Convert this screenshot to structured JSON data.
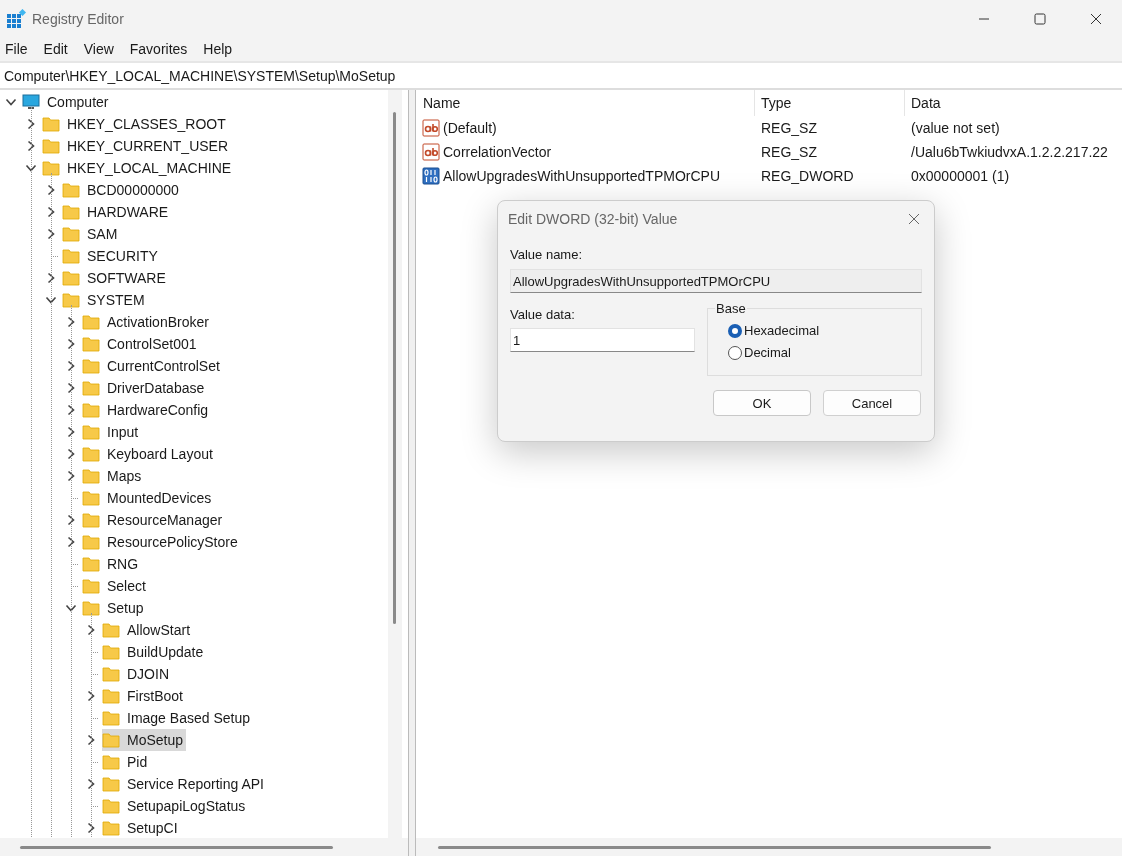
{
  "window": {
    "title": "Registry Editor"
  },
  "menu": [
    "File",
    "Edit",
    "View",
    "Favorites",
    "Help"
  ],
  "address": "Computer\\HKEY_LOCAL_MACHINE\\SYSTEM\\Setup\\MoSetup",
  "tree": [
    {
      "label": "Computer",
      "kind": "computer",
      "expandable": true,
      "expanded": true,
      "selected": false,
      "children": [
        {
          "label": "HKEY_CLASSES_ROOT",
          "kind": "folder",
          "expandable": true,
          "expanded": false,
          "selected": false
        },
        {
          "label": "HKEY_CURRENT_USER",
          "kind": "folder",
          "expandable": true,
          "expanded": false,
          "selected": false
        },
        {
          "label": "HKEY_LOCAL_MACHINE",
          "kind": "folder",
          "expandable": true,
          "expanded": true,
          "selected": false,
          "children": [
            {
              "label": "BCD00000000",
              "kind": "folder",
              "expandable": true,
              "expanded": false,
              "selected": false
            },
            {
              "label": "HARDWARE",
              "kind": "folder",
              "expandable": true,
              "expanded": false,
              "selected": false
            },
            {
              "label": "SAM",
              "kind": "folder",
              "expandable": true,
              "expanded": false,
              "selected": false
            },
            {
              "label": "SECURITY",
              "kind": "folder",
              "expandable": false,
              "selected": false
            },
            {
              "label": "SOFTWARE",
              "kind": "folder",
              "expandable": true,
              "expanded": false,
              "selected": false
            },
            {
              "label": "SYSTEM",
              "kind": "folder",
              "expandable": true,
              "expanded": true,
              "selected": false,
              "children": [
                {
                  "label": "ActivationBroker",
                  "kind": "folder",
                  "expandable": true,
                  "expanded": false,
                  "selected": false
                },
                {
                  "label": "ControlSet001",
                  "kind": "folder",
                  "expandable": true,
                  "expanded": false,
                  "selected": false
                },
                {
                  "label": "CurrentControlSet",
                  "kind": "folder",
                  "expandable": true,
                  "expanded": false,
                  "selected": false
                },
                {
                  "label": "DriverDatabase",
                  "kind": "folder",
                  "expandable": true,
                  "expanded": false,
                  "selected": false
                },
                {
                  "label": "HardwareConfig",
                  "kind": "folder",
                  "expandable": true,
                  "expanded": false,
                  "selected": false
                },
                {
                  "label": "Input",
                  "kind": "folder",
                  "expandable": true,
                  "expanded": false,
                  "selected": false
                },
                {
                  "label": "Keyboard Layout",
                  "kind": "folder",
                  "expandable": true,
                  "expanded": false,
                  "selected": false
                },
                {
                  "label": "Maps",
                  "kind": "folder",
                  "expandable": true,
                  "expanded": false,
                  "selected": false
                },
                {
                  "label": "MountedDevices",
                  "kind": "folder",
                  "expandable": false,
                  "selected": false
                },
                {
                  "label": "ResourceManager",
                  "kind": "folder",
                  "expandable": true,
                  "expanded": false,
                  "selected": false
                },
                {
                  "label": "ResourcePolicyStore",
                  "kind": "folder",
                  "expandable": true,
                  "expanded": false,
                  "selected": false
                },
                {
                  "label": "RNG",
                  "kind": "folder",
                  "expandable": false,
                  "selected": false
                },
                {
                  "label": "Select",
                  "kind": "folder",
                  "expandable": false,
                  "selected": false
                },
                {
                  "label": "Setup",
                  "kind": "folder",
                  "expandable": true,
                  "expanded": true,
                  "selected": false,
                  "children": [
                    {
                      "label": "AllowStart",
                      "kind": "folder",
                      "expandable": true,
                      "expanded": false,
                      "selected": false
                    },
                    {
                      "label": "BuildUpdate",
                      "kind": "folder",
                      "expandable": false,
                      "selected": false
                    },
                    {
                      "label": "DJOIN",
                      "kind": "folder",
                      "expandable": false,
                      "selected": false
                    },
                    {
                      "label": "FirstBoot",
                      "kind": "folder",
                      "expandable": true,
                      "expanded": false,
                      "selected": false
                    },
                    {
                      "label": "Image Based Setup",
                      "kind": "folder",
                      "expandable": false,
                      "selected": false
                    },
                    {
                      "label": "MoSetup",
                      "kind": "folder",
                      "expandable": true,
                      "expanded": false,
                      "selected": true
                    },
                    {
                      "label": "Pid",
                      "kind": "folder",
                      "expandable": false,
                      "selected": false
                    },
                    {
                      "label": "Service Reporting API",
                      "kind": "folder",
                      "expandable": true,
                      "expanded": false,
                      "selected": false
                    },
                    {
                      "label": "SetupapiLogStatus",
                      "kind": "folder",
                      "expandable": false,
                      "selected": false
                    },
                    {
                      "label": "SetupCI",
                      "kind": "folder",
                      "expandable": true,
                      "expanded": false,
                      "selected": false
                    }
                  ]
                }
              ]
            }
          ]
        }
      ]
    }
  ],
  "values": {
    "columns": [
      "Name",
      "Type",
      "Data"
    ],
    "rows": [
      {
        "kind": "string",
        "name": "(Default)",
        "type": "REG_SZ",
        "data": "(value not set)"
      },
      {
        "kind": "string",
        "name": "CorrelationVector",
        "type": "REG_SZ",
        "data": "/Ualu6bTwkiudvxA.1.2.2.217.22"
      },
      {
        "kind": "binary",
        "name": "AllowUpgradesWithUnsupportedTPMOrCPU",
        "type": "REG_DWORD",
        "data": "0x00000001 (1)"
      }
    ]
  },
  "dialog": {
    "title": "Edit DWORD (32-bit) Value",
    "name_label": "Value name:",
    "name_value": "AllowUpgradesWithUnsupportedTPMOrCPU",
    "data_label": "Value data:",
    "data_value": "1",
    "base_label": "Base",
    "bases": [
      {
        "label": "Hexadecimal",
        "selected": true
      },
      {
        "label": "Decimal",
        "selected": false
      }
    ],
    "buttons": [
      {
        "label": "OK",
        "kind": "primary"
      },
      {
        "label": "Cancel",
        "kind": "secondary"
      }
    ]
  }
}
